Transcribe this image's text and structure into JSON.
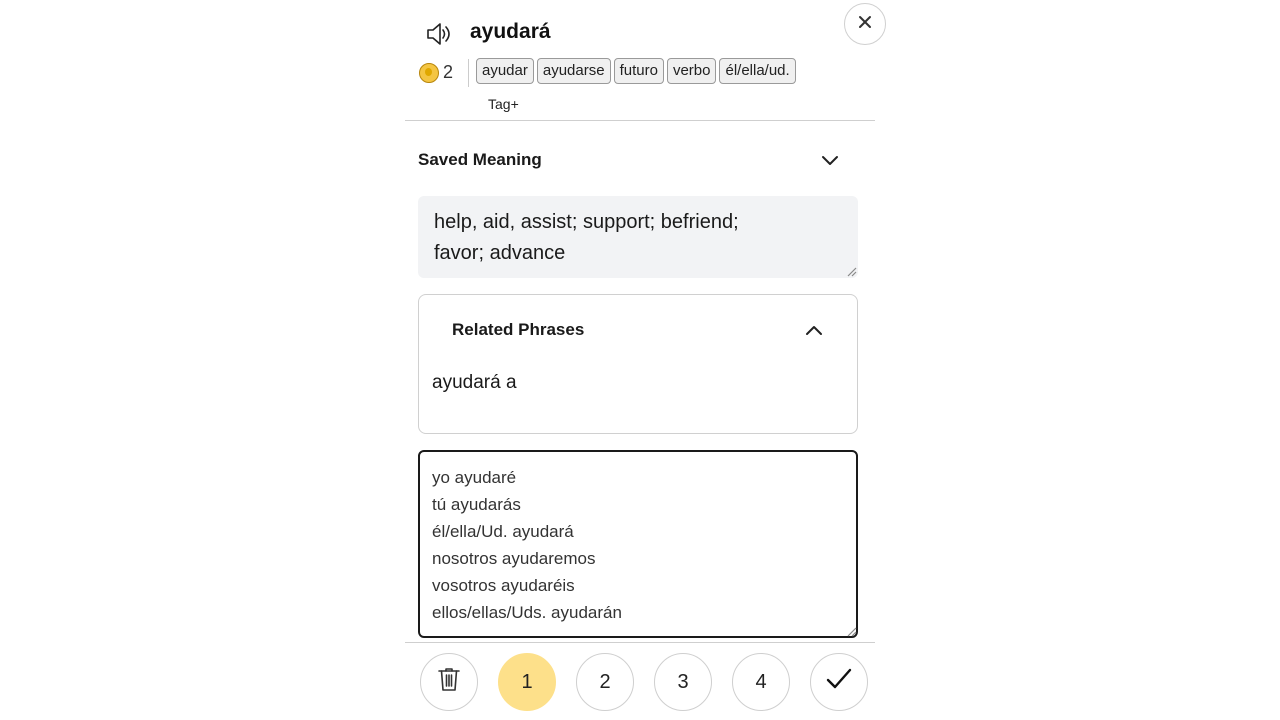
{
  "header": {
    "word": "ayudará",
    "count": "2",
    "tags": [
      "ayudar",
      "ayudarse",
      "futuro",
      "verbo",
      "él/ella/ud."
    ],
    "tag_add_label": "Tag+"
  },
  "saved_meaning": {
    "title": "Saved Meaning",
    "lines": [
      "help, aid, assist; support; befriend;",
      "favor; advance"
    ]
  },
  "related_phrases": {
    "title": "Related Phrases",
    "phrase": "ayudará a"
  },
  "notes": {
    "lines": [
      "yo ayudaré",
      "tú ayudarás",
      "él/ella/Ud. ayudará",
      "nosotros ayudaremos",
      "vosotros ayudaréis",
      "ellos/ellas/Uds. ayudarán"
    ]
  },
  "rating": {
    "buttons": [
      "1",
      "2",
      "3",
      "4"
    ],
    "selected": "1"
  },
  "colors": {
    "accent": "#fde08a",
    "coin": "#f4c542"
  }
}
